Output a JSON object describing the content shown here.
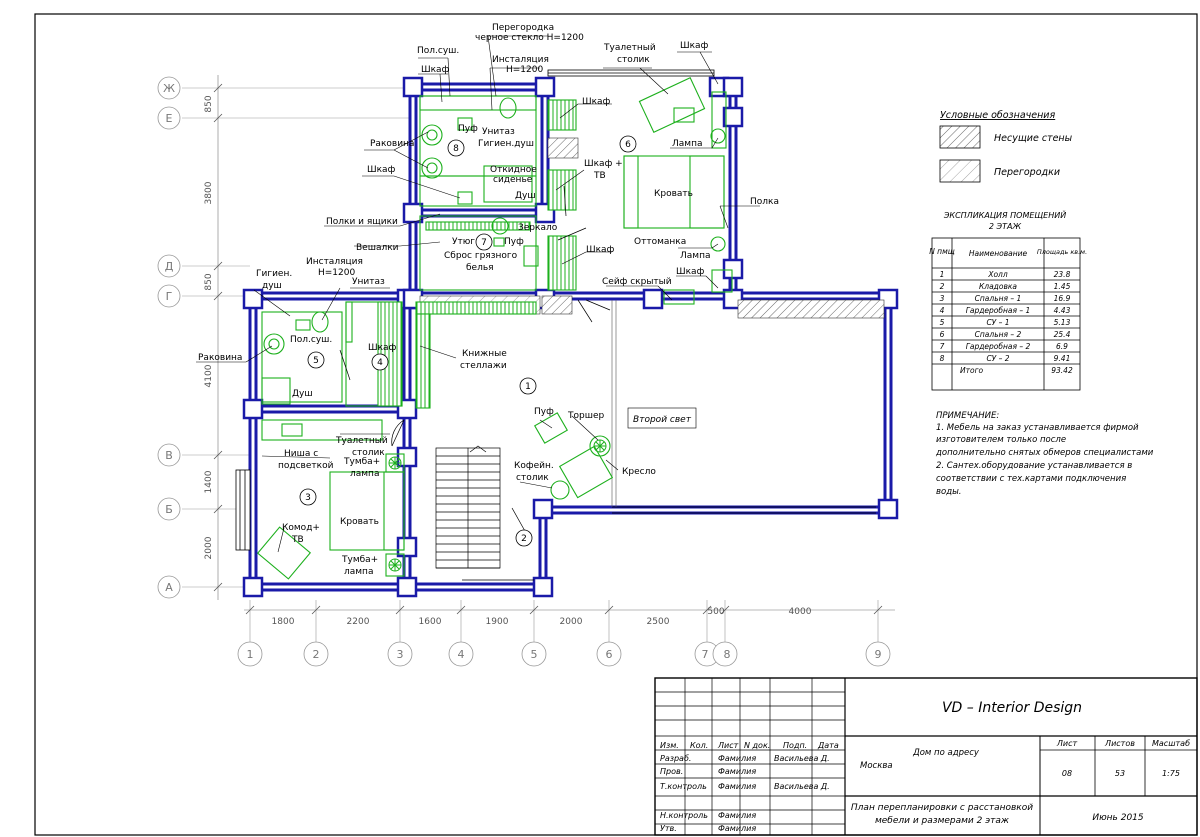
{
  "legend": {
    "title": "Условные обозначения",
    "items": [
      {
        "label": "Несущие стены"
      },
      {
        "label": "Перегородки"
      }
    ]
  },
  "explication": {
    "title": "ЭКСПЛИКАЦИЯ ПОМЕЩЕНИЙ",
    "subtitle": "2 ЭТАЖ",
    "headers": [
      "N пмщ",
      "Наименование",
      "Площадь кв.м."
    ],
    "rows": [
      {
        "n": "1",
        "name": "Холл",
        "area": "23.8"
      },
      {
        "n": "2",
        "name": "Кладовка",
        "area": "1.45"
      },
      {
        "n": "3",
        "name": "Спальня – 1",
        "area": "16.9"
      },
      {
        "n": "4",
        "name": "Гардеробная – 1",
        "area": "4.43"
      },
      {
        "n": "5",
        "name": "СУ – 1",
        "area": "5.13"
      },
      {
        "n": "6",
        "name": "Спальня – 2",
        "area": "25.4"
      },
      {
        "n": "7",
        "name": "Гардеробная – 2",
        "area": "6.9"
      },
      {
        "n": "8",
        "name": "СУ – 2",
        "area": "9.41"
      }
    ],
    "total_label": "Итого",
    "total_value": "93.42"
  },
  "note": {
    "title": "ПРИМЕЧАНИЕ:",
    "lines": [
      "1. Мебель на заказ устанавливается фирмой",
      "изготовителем только после",
      "дополнительно снятых обмеров специалистами",
      "2. Сантех.оборудование устанавливается в",
      "соответствии с тех.картами подключения",
      "воды."
    ]
  },
  "axes": {
    "letters": [
      "Ж",
      "Е",
      "Д",
      "Г",
      "В",
      "Б",
      "А"
    ],
    "numbers": [
      "1",
      "2",
      "3",
      "4",
      "5",
      "6",
      "7",
      "8",
      "9"
    ],
    "left_dims": [
      "850",
      "3800",
      "850",
      "4100",
      "1400",
      "2000"
    ],
    "bottom_dims": [
      "1800",
      "2200",
      "1600",
      "1900",
      "2000",
      "2500",
      "500",
      "4000"
    ]
  },
  "rooms": [
    "1",
    "2",
    "3",
    "4",
    "5",
    "6",
    "7",
    "8"
  ],
  "labels": {
    "peregorodka": "Перегородка",
    "chernoe_steklo": "черное стекло Н=1200",
    "instal_top": "Инсталяция",
    "instal_top_h": "Н=1200",
    "pol_sush_top": "Пол.суш.",
    "shkaf_a": "Шкаф",
    "tualet_stolik_top": "Туалетный",
    "stolik_top": "столик",
    "shkaf_b": "Шкаф",
    "shkaf_c": "Шкаф",
    "puf_a": "Пуф",
    "unitaz_a": "Унитаз",
    "gigien_dush_a": "Гигиен.душ",
    "rakovina_a": "Раковина",
    "lampa_a": "Лампа",
    "otkidnoe": "Откидное",
    "sidenie": "сиденье",
    "dush_a": "Душ",
    "shkaf_tv": "Шкаф +",
    "tv_a": "ТВ",
    "krovat_a": "Кровать",
    "shkaf_d": "Шкаф",
    "polka": "Полка",
    "polki_yashiki": "Полки и ящики",
    "zerkalo": "Зеркало",
    "utyug": "Утюг",
    "puf_b": "Пуф",
    "veshalki": "Вешалки",
    "sbros_1": "Сброс грязного",
    "sbros_2": "белья",
    "ottomanka": "Оттоманка",
    "lampa_b": "Лампа",
    "shkaf_e": "Шкаф",
    "shkaf_f": "Шкаф",
    "seyf": "Сейф скрытый",
    "gigien_dush_b1": "Гигиен.",
    "gigien_dush_b2": "душ",
    "instal_left": "Инсталяция",
    "instal_left_h": "Н=1200",
    "unitaz_b": "Унитаз",
    "pol_sush_b": "Пол.суш.",
    "rakovina_b": "Раковина",
    "shkaf_g": "Шкаф",
    "dush_b": "Душ",
    "knizhnye_1": "Книжные",
    "knizhnye_2": "стеллажи",
    "puf_c": "Пуф",
    "torsher": "Торшер",
    "vtoroy_svet": "Второй свет",
    "tualet_stolik_b": "Туалетный",
    "stolik_b": "столик",
    "nisha_1": "Ниша с",
    "nisha_2": "подсветкой",
    "tumba_a1": "Тумба+",
    "tumba_a2": "лампа",
    "kofein_1": "Кофейн.",
    "kofein_2": "столик",
    "kreslo": "Кресло",
    "komod_1": "Комод+",
    "komod_2": "ТВ",
    "krovat_b": "Кровать",
    "tumba_b1": "Тумба+",
    "tumba_b2": "лампа"
  },
  "title_block": {
    "company": "VD – Interior Design",
    "hdr_izm": "Изм.",
    "hdr_kol": "Кол.",
    "hdr_list": "Лист",
    "hdr_ndok": "N док.",
    "hdr_podp": "Подп.",
    "hdr_data": "Дата",
    "roles": [
      {
        "role": "Разраб.",
        "name": "Фамилия",
        "sign": "Васильева Д."
      },
      {
        "role": "Пров.",
        "name": "Фамилия",
        "sign": ""
      },
      {
        "role": "Т.контроль",
        "name": "Фамилия",
        "sign": "Васильева Д."
      },
      {
        "role": "Н.контроль",
        "name": "Фамилия",
        "sign": ""
      },
      {
        "role": "Утв.",
        "name": "Фамилия",
        "sign": ""
      }
    ],
    "project": "Дом по адресу",
    "city": "Москва",
    "sheet_label": "Лист",
    "sheets_label": "Листов",
    "scale_label": "Масштаб",
    "sheet": "08",
    "sheets": "53",
    "scale": "1:75",
    "plan_title_1": "План перепланировки с расстановкой",
    "plan_title_2": "мебели и размерами 2 этаж",
    "date": "Июнь 2015"
  },
  "colors": {
    "wall": "#1a1aa8",
    "furniture": "#1db01d",
    "lines": "#000000",
    "grid": "#888888"
  }
}
